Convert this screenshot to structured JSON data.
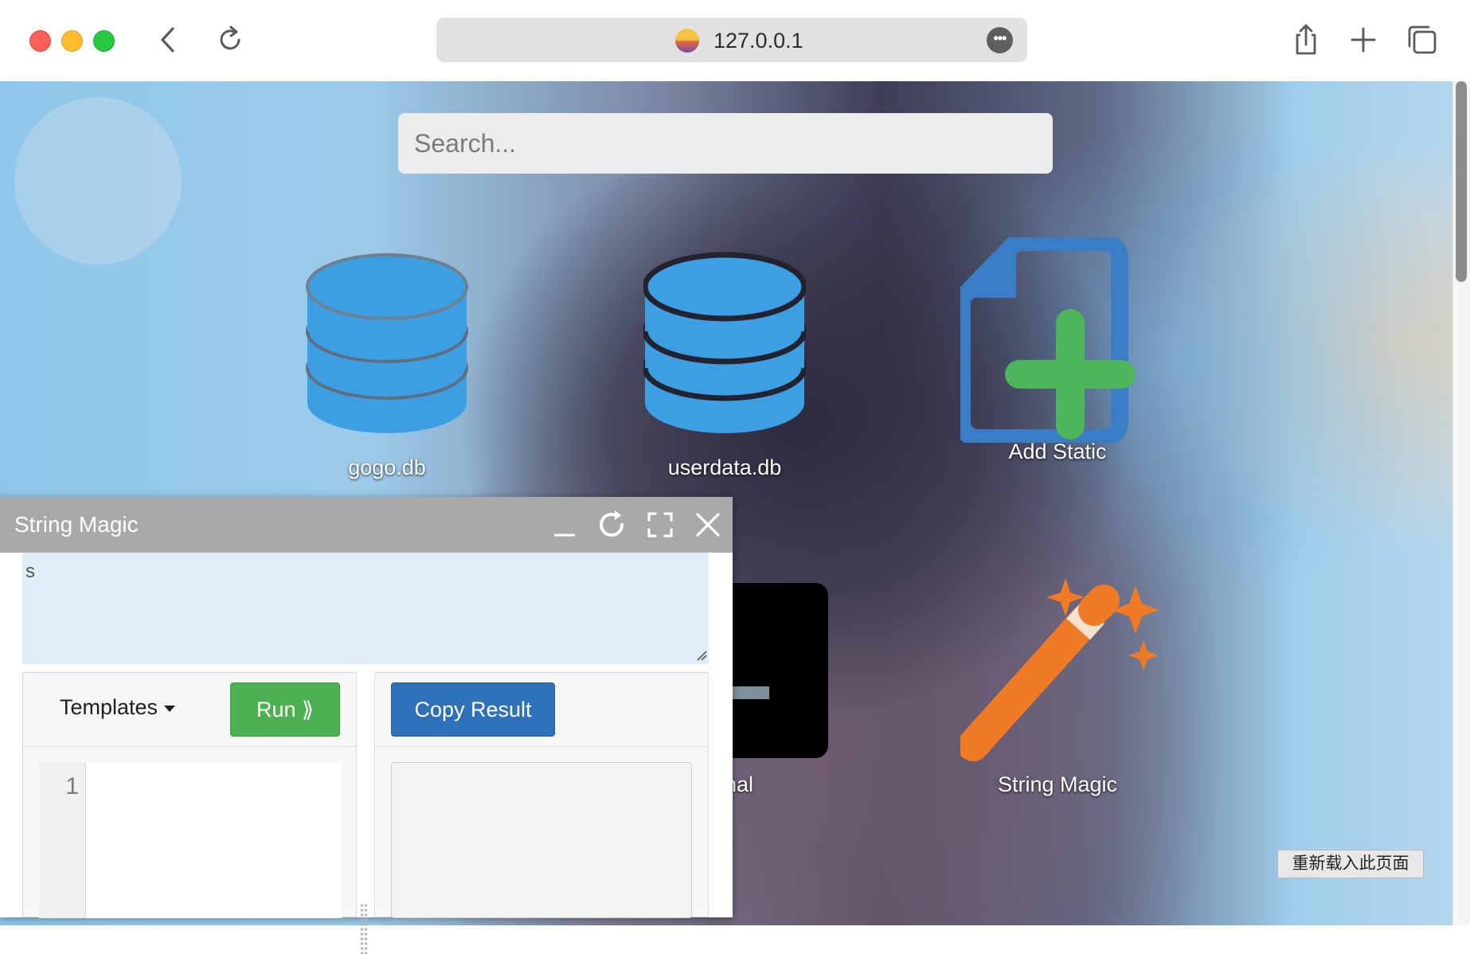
{
  "browser": {
    "url": "127.0.0.1",
    "more_label": "•••"
  },
  "page": {
    "search_placeholder": "Search...",
    "apps": [
      {
        "label": "gogo.db",
        "icon": "database-icon"
      },
      {
        "label": "userdata.db",
        "icon": "database-icon"
      },
      {
        "label": "Add Static",
        "icon": "add-file-icon"
      },
      {
        "label": "inal",
        "icon": "terminal-icon"
      },
      {
        "label": "String Magic",
        "icon": "magic-wand-icon"
      }
    ],
    "reload_label": "重新载入此页面"
  },
  "string_magic": {
    "title": "String Magic",
    "input_value": "s",
    "templates_label": "Templates",
    "run_label": "Run ⟫",
    "copy_label": "Copy Result",
    "line_number": "1"
  },
  "colors": {
    "database_blue": "#3d9ee3",
    "file_blue": "#3b7cc6",
    "plus_green": "#4fb55a",
    "wand_orange": "#f07a25",
    "run_green": "#4db151",
    "copy_blue": "#2f71b8",
    "window_titlebar": "#a9a9a9"
  }
}
